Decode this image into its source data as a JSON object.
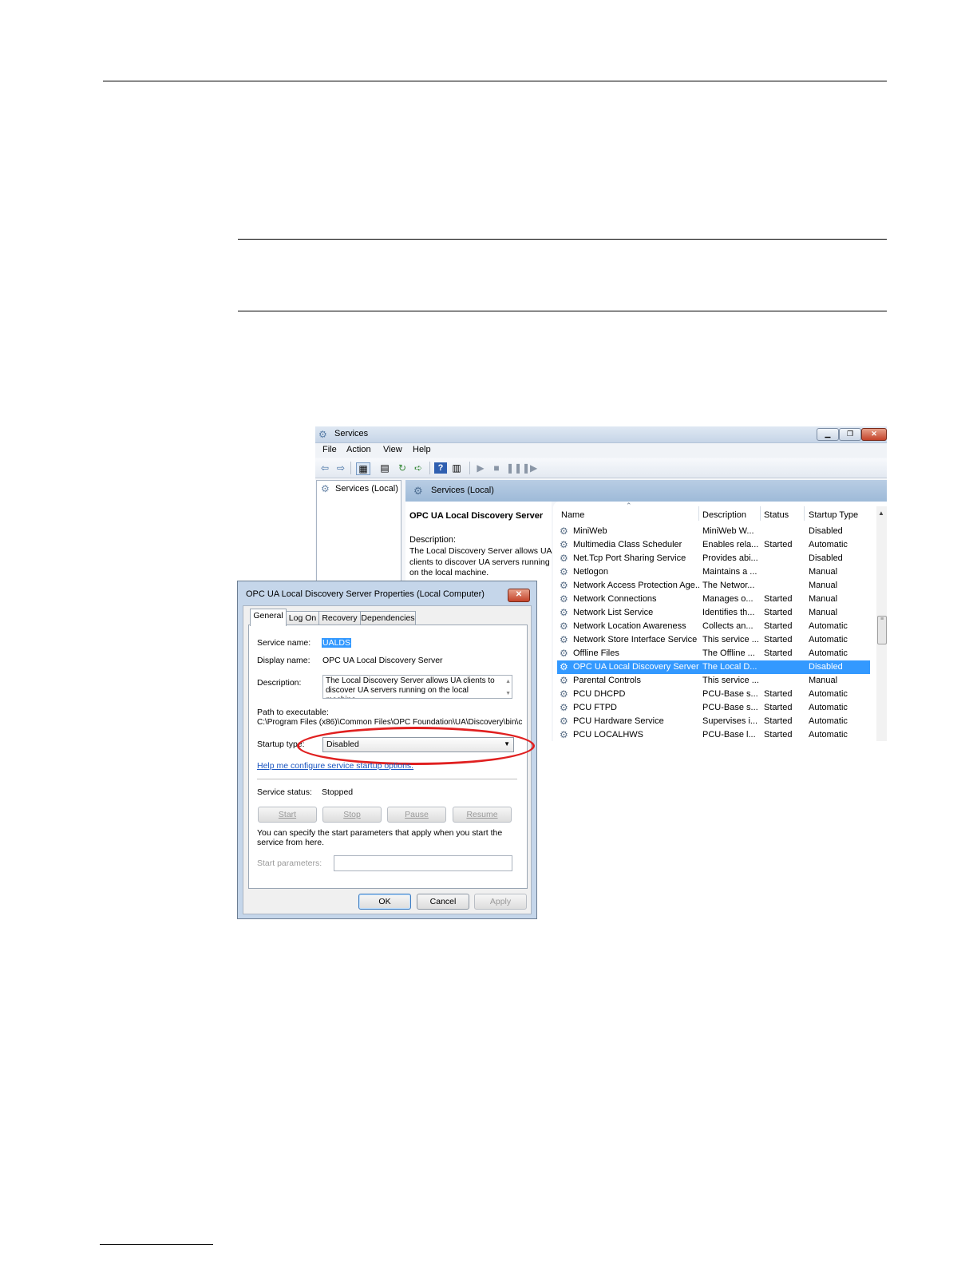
{
  "services_window": {
    "title": "Services",
    "menu": [
      "File",
      "Action",
      "View",
      "Help"
    ],
    "tree_item": "Services (Local)",
    "header": "Services (Local)",
    "detail": {
      "name": "OPC UA Local Discovery Server",
      "label": "Description:",
      "text": "The Local Discovery Server allows UA clients to discover UA servers running on the local machine."
    },
    "columns": [
      "Name",
      "Description",
      "Status",
      "Startup Type"
    ],
    "rows": [
      {
        "name": "MiniWeb",
        "description": "MiniWeb W...",
        "status": "",
        "startup": "Disabled"
      },
      {
        "name": "Multimedia Class Scheduler",
        "description": "Enables rela...",
        "status": "Started",
        "startup": "Automatic"
      },
      {
        "name": "Net.Tcp Port Sharing Service",
        "description": "Provides abi...",
        "status": "",
        "startup": "Disabled"
      },
      {
        "name": "Netlogon",
        "description": "Maintains a ...",
        "status": "",
        "startup": "Manual"
      },
      {
        "name": "Network Access Protection Age...",
        "description": "The Networ...",
        "status": "",
        "startup": "Manual"
      },
      {
        "name": "Network Connections",
        "description": "Manages o...",
        "status": "Started",
        "startup": "Manual"
      },
      {
        "name": "Network List Service",
        "description": "Identifies th...",
        "status": "Started",
        "startup": "Manual"
      },
      {
        "name": "Network Location Awareness",
        "description": "Collects an...",
        "status": "Started",
        "startup": "Automatic"
      },
      {
        "name": "Network Store Interface Service",
        "description": "This service ...",
        "status": "Started",
        "startup": "Automatic"
      },
      {
        "name": "Offline Files",
        "description": "The Offline ...",
        "status": "Started",
        "startup": "Automatic"
      },
      {
        "name": "OPC UA Local Discovery Server",
        "description": "The Local D...",
        "status": "",
        "startup": "Disabled",
        "selected": true
      },
      {
        "name": "Parental Controls",
        "description": "This service ...",
        "status": "",
        "startup": "Manual"
      },
      {
        "name": "PCU DHCPD",
        "description": "PCU-Base s...",
        "status": "Started",
        "startup": "Automatic"
      },
      {
        "name": "PCU FTPD",
        "description": "PCU-Base s...",
        "status": "Started",
        "startup": "Automatic"
      },
      {
        "name": "PCU Hardware Service",
        "description": "Supervises i...",
        "status": "Started",
        "startup": "Automatic"
      },
      {
        "name": "PCU LOCALHWS",
        "description": "PCU-Base l...",
        "status": "Started",
        "startup": "Automatic"
      }
    ]
  },
  "dialog": {
    "title": "OPC UA Local Discovery Server Properties (Local Computer)",
    "tabs": [
      "General",
      "Log On",
      "Recovery",
      "Dependencies"
    ],
    "service_name_label": "Service name:",
    "service_name": "UALDS",
    "display_name_label": "Display name:",
    "display_name": "OPC UA Local Discovery Server",
    "description_label": "Description:",
    "description": "The Local Discovery Server allows UA clients to discover UA servers running on the local machine.",
    "path_label": "Path to executable:",
    "path": "C:\\Program Files (x86)\\Common Files\\OPC Foundation\\UA\\Discovery\\bin\\c",
    "startup_type_label": "Startup type:",
    "startup_type": "Disabled",
    "help_link": "Help me configure service startup options.",
    "status_label": "Service status:",
    "status": "Stopped",
    "buttons": {
      "start": "Start",
      "stop": "Stop",
      "pause": "Pause",
      "resume": "Resume"
    },
    "params_text": "You can specify the start parameters that apply when you start the service from here.",
    "params_label": "Start parameters:",
    "ok": "OK",
    "cancel": "Cancel",
    "apply": "Apply"
  }
}
